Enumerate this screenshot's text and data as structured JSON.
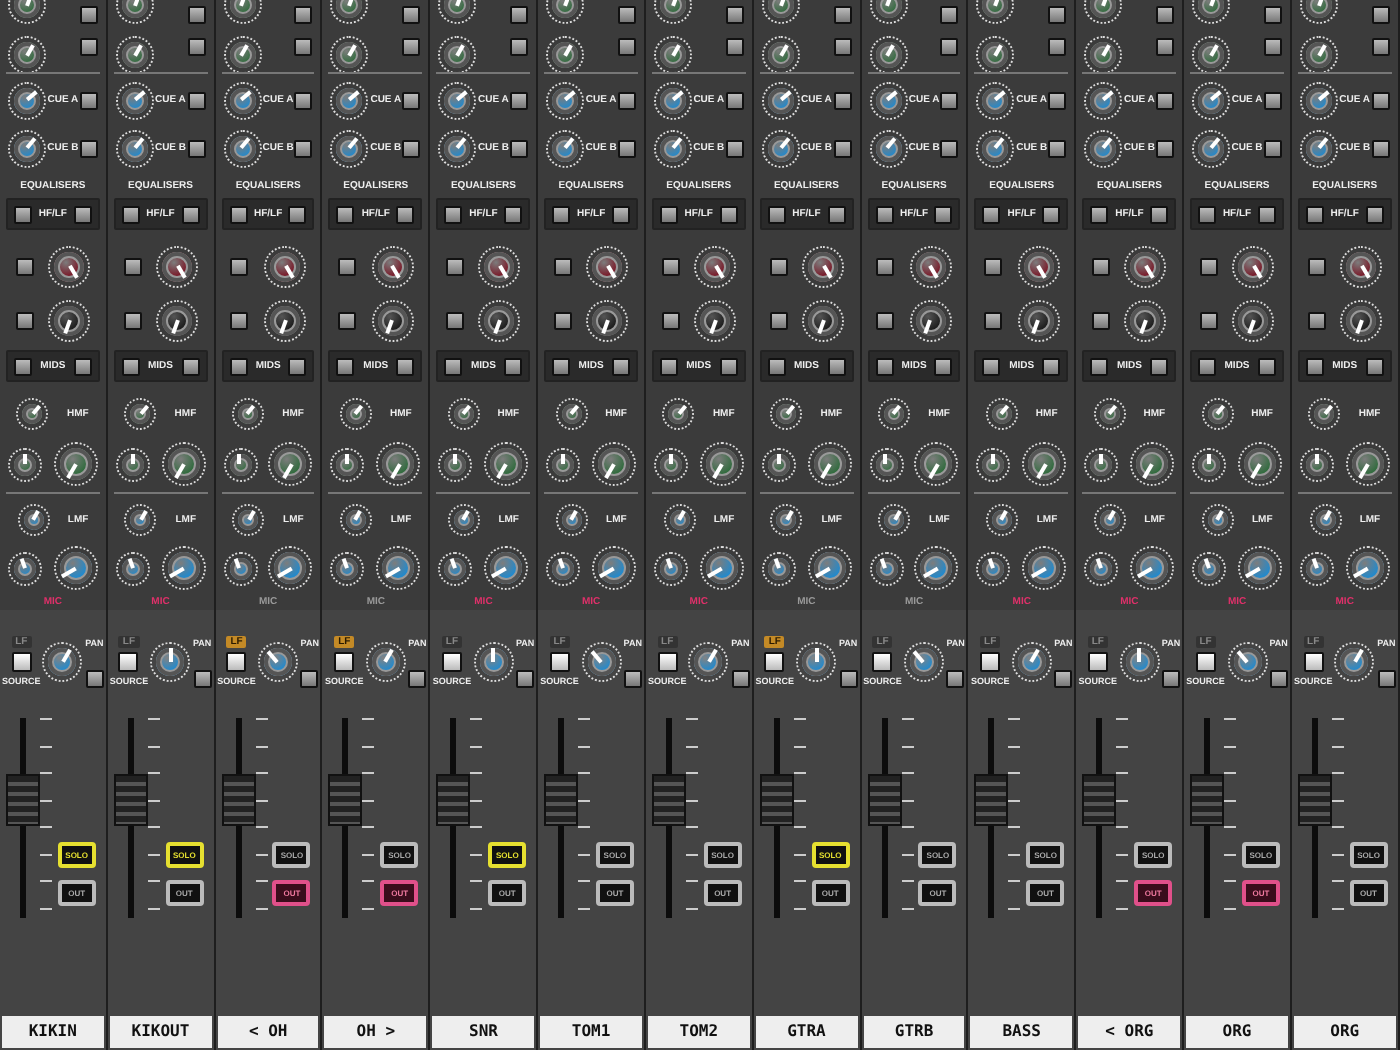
{
  "channels": [
    {
      "name": "KIKIN",
      "cue_a": "CUE A",
      "cue_b": "CUE B",
      "eq": "EQUALISERS",
      "hflf": "HF/LF",
      "mids": "MIDS",
      "hmf": "HMF",
      "lmf": "LMF",
      "mic": "MIC",
      "mic_lit": true,
      "lf": "LF",
      "lf_lit": false,
      "source": "SOURCE",
      "pan": "PAN",
      "solo": "SOLO",
      "solo_on": true,
      "cut": "OUT",
      "cut_on": false,
      "fader": {
        "level": 0.62
      }
    },
    {
      "name": "KIKOUT",
      "cue_a": "CUE A",
      "cue_b": "CUE B",
      "eq": "EQUALISERS",
      "hflf": "HF/LF",
      "mids": "MIDS",
      "hmf": "HMF",
      "lmf": "LMF",
      "mic": "MIC",
      "mic_lit": true,
      "lf": "LF",
      "lf_lit": false,
      "source": "SOURCE",
      "pan": "PAN",
      "solo": "SOLO",
      "solo_on": true,
      "cut": "OUT",
      "cut_on": false,
      "fader": {
        "level": 0.62
      }
    },
    {
      "name": "< OH",
      "cue_a": "CUE A",
      "cue_b": "CUE B",
      "eq": "EQUALISERS",
      "hflf": "HF/LF",
      "mids": "MIDS",
      "hmf": "HMF",
      "lmf": "LMF",
      "mic": "MIC",
      "mic_lit": false,
      "lf": "LF",
      "lf_lit": true,
      "source": "SOURCE",
      "pan": "PAN",
      "solo": "SOLO",
      "solo_on": false,
      "cut": "OUT",
      "cut_on": true,
      "fader": {
        "level": 0.62
      }
    },
    {
      "name": "OH >",
      "cue_a": "CUE A",
      "cue_b": "CUE B",
      "eq": "EQUALISERS",
      "hflf": "HF/LF",
      "mids": "MIDS",
      "hmf": "HMF",
      "lmf": "LMF",
      "mic": "MIC",
      "mic_lit": false,
      "lf": "LF",
      "lf_lit": true,
      "source": "SOURCE",
      "pan": "PAN",
      "solo": "SOLO",
      "solo_on": false,
      "cut": "OUT",
      "cut_on": true,
      "fader": {
        "level": 0.62
      }
    },
    {
      "name": "SNR",
      "cue_a": "CUE A",
      "cue_b": "CUE B",
      "eq": "EQUALISERS",
      "hflf": "HF/LF",
      "mids": "MIDS",
      "hmf": "HMF",
      "lmf": "LMF",
      "mic": "MIC",
      "mic_lit": true,
      "lf": "LF",
      "lf_lit": false,
      "source": "SOURCE",
      "pan": "PAN",
      "solo": "SOLO",
      "solo_on": true,
      "cut": "OUT",
      "cut_on": false,
      "fader": {
        "level": 0.62
      }
    },
    {
      "name": "TOM1",
      "cue_a": "CUE A",
      "cue_b": "CUE B",
      "eq": "EQUALISERS",
      "hflf": "HF/LF",
      "mids": "MIDS",
      "hmf": "HMF",
      "lmf": "LMF",
      "mic": "MIC",
      "mic_lit": true,
      "lf": "LF",
      "lf_lit": false,
      "source": "SOURCE",
      "pan": "PAN",
      "solo": "SOLO",
      "solo_on": false,
      "cut": "OUT",
      "cut_on": false,
      "fader": {
        "level": 0.62
      }
    },
    {
      "name": "TOM2",
      "cue_a": "CUE A",
      "cue_b": "CUE B",
      "eq": "EQUALISERS",
      "hflf": "HF/LF",
      "mids": "MIDS",
      "hmf": "HMF",
      "lmf": "LMF",
      "mic": "MIC",
      "mic_lit": true,
      "lf": "LF",
      "lf_lit": false,
      "source": "SOURCE",
      "pan": "PAN",
      "solo": "SOLO",
      "solo_on": false,
      "cut": "OUT",
      "cut_on": false,
      "fader": {
        "level": 0.62
      }
    },
    {
      "name": "GTRA",
      "cue_a": "CUE A",
      "cue_b": "CUE B",
      "eq": "EQUALISERS",
      "hflf": "HF/LF",
      "mids": "MIDS",
      "hmf": "HMF",
      "lmf": "LMF",
      "mic": "MIC",
      "mic_lit": false,
      "lf": "LF",
      "lf_lit": true,
      "source": "SOURCE",
      "pan": "PAN",
      "solo": "SOLO",
      "solo_on": true,
      "cut": "OUT",
      "cut_on": false,
      "fader": {
        "level": 0.62
      }
    },
    {
      "name": "GTRB",
      "cue_a": "CUE A",
      "cue_b": "CUE B",
      "eq": "EQUALISERS",
      "hflf": "HF/LF",
      "mids": "MIDS",
      "hmf": "HMF",
      "lmf": "LMF",
      "mic": "MIC",
      "mic_lit": false,
      "lf": "LF",
      "lf_lit": false,
      "source": "SOURCE",
      "pan": "PAN",
      "solo": "SOLO",
      "solo_on": false,
      "cut": "OUT",
      "cut_on": false,
      "fader": {
        "level": 0.62
      }
    },
    {
      "name": "BASS",
      "cue_a": "CUE A",
      "cue_b": "CUE B",
      "eq": "EQUALISERS",
      "hflf": "HF/LF",
      "mids": "MIDS",
      "hmf": "HMF",
      "lmf": "LMF",
      "mic": "MIC",
      "mic_lit": true,
      "lf": "LF",
      "lf_lit": false,
      "source": "SOURCE",
      "pan": "PAN",
      "solo": "SOLO",
      "solo_on": false,
      "cut": "OUT",
      "cut_on": false,
      "fader": {
        "level": 0.62
      }
    },
    {
      "name": "< ORG",
      "cue_a": "CUE A",
      "cue_b": "CUE B",
      "eq": "EQUALISERS",
      "hflf": "HF/LF",
      "mids": "MIDS",
      "hmf": "HMF",
      "lmf": "LMF",
      "mic": "MIC",
      "mic_lit": true,
      "lf": "LF",
      "lf_lit": false,
      "source": "SOURCE",
      "pan": "PAN",
      "solo": "SOLO",
      "solo_on": false,
      "cut": "OUT",
      "cut_on": true,
      "fader": {
        "level": 0.62
      }
    },
    {
      "name": "ORG",
      "cue_a": "CUE A",
      "cue_b": "CUE B",
      "eq": "EQUALISERS",
      "hflf": "HF/LF",
      "mids": "MIDS",
      "hmf": "HMF",
      "lmf": "LMF",
      "mic": "MIC",
      "mic_lit": true,
      "lf": "LF",
      "lf_lit": false,
      "source": "SOURCE",
      "pan": "PAN",
      "solo": "SOLO",
      "solo_on": false,
      "cut": "OUT",
      "cut_on": true,
      "fader": {
        "level": 0.62
      }
    },
    {
      "name": "ORG",
      "cue_a": "CUE A",
      "cue_b": "CUE B",
      "eq": "EQUALISERS",
      "hflf": "HF/LF",
      "mids": "MIDS",
      "hmf": "HMF",
      "lmf": "LMF",
      "mic": "MIC",
      "mic_lit": true,
      "lf": "LF",
      "lf_lit": false,
      "source": "SOURCE",
      "pan": "PAN",
      "solo": "SOLO",
      "solo_on": false,
      "cut": "OUT",
      "cut_on": false,
      "fader": {
        "level": 0.62
      }
    }
  ]
}
